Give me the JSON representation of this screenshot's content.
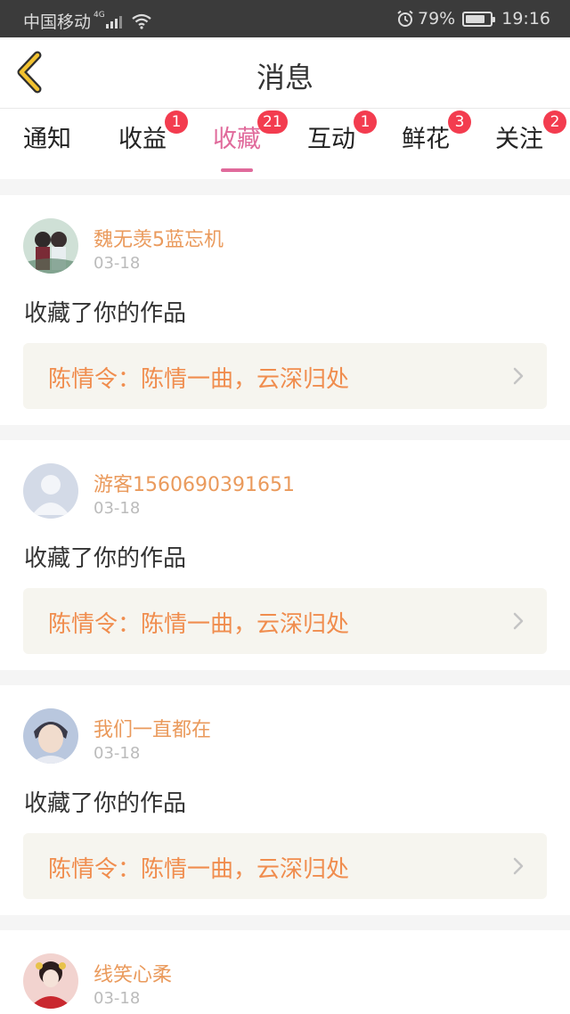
{
  "status_bar": {
    "carrier": "中国移动",
    "network": "4G",
    "battery": "79%",
    "battery_level": 0.79,
    "time": "19:16"
  },
  "header": {
    "title": "消息",
    "back_icon": "chevron-left-icon"
  },
  "tabs": [
    {
      "label": "通知",
      "badge": ""
    },
    {
      "label": "收益",
      "badge": "1"
    },
    {
      "label": "收藏",
      "badge": "21",
      "active": true
    },
    {
      "label": "互动",
      "badge": "1"
    },
    {
      "label": "鲜花",
      "badge": "3"
    },
    {
      "label": "关注",
      "badge": "2"
    }
  ],
  "messages": [
    {
      "user": "魏无羡5蓝忘机",
      "date": "03-18",
      "action": "收藏了你的作品",
      "work": "陈情令：陈情一曲，云深归处"
    },
    {
      "user": "游客1560690391651",
      "date": "03-18",
      "action": "收藏了你的作品",
      "work": "陈情令：陈情一曲，云深归处"
    },
    {
      "user": "我们一直都在",
      "date": "03-18",
      "action": "收藏了你的作品",
      "work": "陈情令：陈情一曲，云深归处"
    },
    {
      "user": "线笑心柔",
      "date": "03-18"
    }
  ],
  "colors": {
    "accent": "#e06a9b",
    "badge": "#f33c4f",
    "username": "#ea9a5c",
    "work_title": "#f08d4e"
  }
}
